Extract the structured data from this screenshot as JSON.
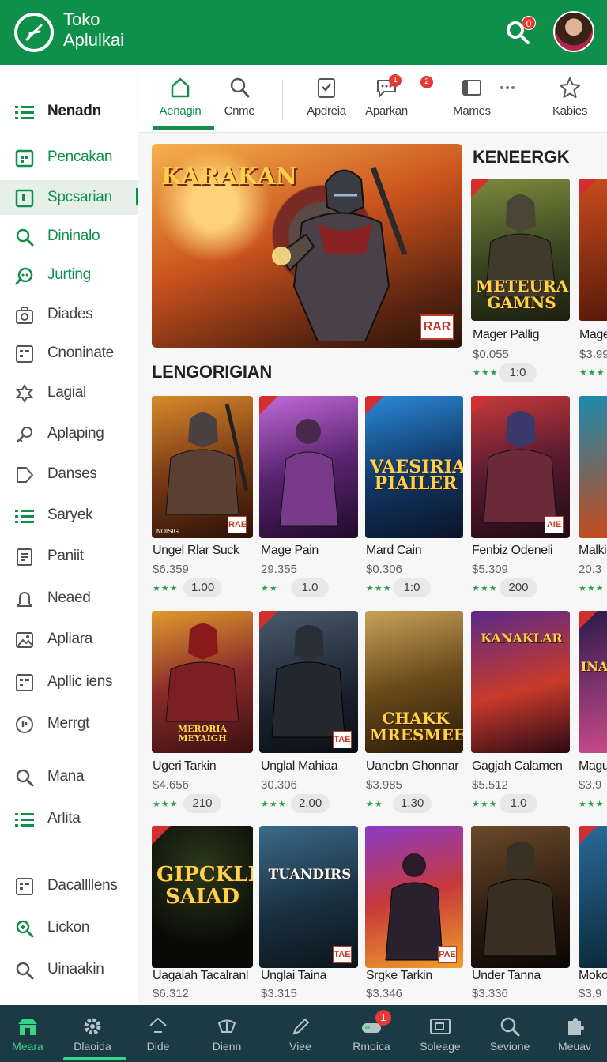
{
  "app": {
    "title": "Toko\nAplulkai",
    "title_line1": "Toko",
    "title_line2": "Aplulkai",
    "notification_count": "0",
    "brand_color": "#0e8f4a"
  },
  "sidebar": {
    "items": [
      {
        "label": "Nenadn",
        "icon": "list-icon"
      },
      {
        "label": "Pencakan",
        "icon": "calendar-icon"
      },
      {
        "label": "Spcsarian",
        "icon": "square-icon"
      },
      {
        "label": "Dininalo",
        "icon": "search-icon"
      },
      {
        "label": "Jurting",
        "icon": "chat-icon"
      },
      {
        "label": "Diades",
        "icon": "camera-icon"
      },
      {
        "label": "Cnoninate",
        "icon": "grid-icon"
      },
      {
        "label": "Lagial",
        "icon": "puzzle-icon"
      },
      {
        "label": "Aplaping",
        "icon": "key-icon"
      },
      {
        "label": "Danses",
        "icon": "tag-icon"
      },
      {
        "label": "Saryek",
        "icon": "list-icon"
      },
      {
        "label": "Paniit",
        "icon": "document-icon"
      },
      {
        "label": "Neaed",
        "icon": "bell-icon"
      },
      {
        "label": "Apliara",
        "icon": "image-icon"
      },
      {
        "label": "Apllic iens",
        "icon": "grid-icon"
      },
      {
        "label": "Merrgt",
        "icon": "clock-icon"
      },
      {
        "label": "Mana",
        "icon": "search-icon"
      },
      {
        "label": "Arlita",
        "icon": "list-icon"
      },
      {
        "label": "Dacallllens",
        "icon": "grid-icon"
      },
      {
        "label": "Lickon",
        "icon": "zoom-icon"
      },
      {
        "label": "Uinaakin",
        "icon": "search-icon"
      }
    ]
  },
  "tabs": [
    {
      "label": "Aenagin",
      "icon": "home-icon",
      "badge": ""
    },
    {
      "label": "Cnme",
      "icon": "search-icon",
      "badge": ""
    },
    {
      "label": "Apdreia",
      "icon": "checklist-icon",
      "badge": ""
    },
    {
      "label": "Aparkan",
      "icon": "chat-icon",
      "badge": "1"
    },
    {
      "label": "",
      "icon": "",
      "badge": "2"
    },
    {
      "label": "Mames",
      "icon": "window-icon",
      "badge": ""
    },
    {
      "label": "",
      "icon": "more-icon",
      "badge": ""
    },
    {
      "label": "Kabies",
      "icon": "star-icon",
      "badge": ""
    }
  ],
  "hero": {
    "title": "KARAKAN",
    "tag": "RAR"
  },
  "sections": {
    "right_title": "KENEERGK",
    "main_title": "LENGORIGIAN"
  },
  "featured": [
    {
      "name": "Mager Pallig",
      "price": "$0.055",
      "stars": "★★★",
      "rating": "1:0",
      "art_text": "METEURA GAMNS"
    },
    {
      "name": "Mage",
      "price": "$3.99",
      "stars": "★★★",
      "rating": "",
      "art_text": ""
    }
  ],
  "rows": [
    [
      {
        "name": "Ungel Rlar Suck",
        "price": "$6.359",
        "stars": "★★★",
        "rating": "1.00",
        "art_text": "",
        "tag": "RAE"
      },
      {
        "name": "Mage Pain",
        "price": "29.355",
        "stars": "★★",
        "rating": "1.0",
        "art_text": "",
        "tag": ""
      },
      {
        "name": "Mard Cain",
        "price": "$0.306",
        "stars": "★★★",
        "rating": "1:0",
        "art_text": "VAESIRIA PIAILER",
        "tag": ""
      },
      {
        "name": "Fenbiz Odeneli",
        "price": "$5.309",
        "stars": "★★★",
        "rating": "200",
        "art_text": "",
        "tag": "AIE"
      },
      {
        "name": "Malki",
        "price": "20.3",
        "stars": "★★★",
        "rating": "",
        "art_text": "",
        "tag": ""
      }
    ],
    [
      {
        "name": "Ugeri Tarkin",
        "price": "$4.656",
        "stars": "★★★",
        "rating": "210",
        "art_text": "MERORIA MEYAIGH",
        "tag": ""
      },
      {
        "name": "Unglal Mahiaa",
        "price": "30.306",
        "stars": "★★★",
        "rating": "2.00",
        "art_text": "",
        "tag": "TAE"
      },
      {
        "name": "Uanebn Ghonnar",
        "price": "$3.985",
        "stars": "★★",
        "rating": "1.30",
        "art_text": "CHAKK MRESMEES",
        "tag": ""
      },
      {
        "name": "Gagjah Calamen",
        "price": "$5.512",
        "stars": "★★★",
        "rating": "1.0",
        "art_text": "KANAKLAR",
        "tag": ""
      },
      {
        "name": "Magu",
        "price": "$3.9",
        "stars": "★★★",
        "rating": "",
        "art_text": "INA",
        "tag": ""
      }
    ],
    [
      {
        "name": "Uagaiah Tacalranl",
        "price": "$6.312",
        "stars": "",
        "rating": "",
        "art_text": "GIPCKLER SAIAD",
        "tag": ""
      },
      {
        "name": "Unglai Taina",
        "price": "$3.315",
        "stars": "",
        "rating": "",
        "art_text": "TUANDIRS",
        "tag": "TAE"
      },
      {
        "name": "Srgke Tarkin",
        "price": "$3.346",
        "stars": "",
        "rating": "",
        "art_text": "",
        "tag": "PAE"
      },
      {
        "name": "Under Tanna",
        "price": "$3.336",
        "stars": "",
        "rating": "",
        "art_text": "",
        "tag": ""
      },
      {
        "name": "Moko",
        "price": "$3.9",
        "stars": "",
        "rating": "",
        "art_text": "",
        "tag": ""
      }
    ]
  ],
  "bottom_nav": [
    {
      "label": "Meara",
      "icon": "store-icon",
      "badge": ""
    },
    {
      "label": "Dlaoida",
      "icon": "gear-icon",
      "badge": ""
    },
    {
      "label": "Dide",
      "icon": "diamond-icon",
      "badge": ""
    },
    {
      "label": "Dienn",
      "icon": "shield-icon",
      "badge": ""
    },
    {
      "label": "Viee",
      "icon": "pencil-icon",
      "badge": ""
    },
    {
      "label": "Rmoica",
      "icon": "gamepad-icon",
      "badge": "1"
    },
    {
      "label": "Soleage",
      "icon": "window-icon",
      "badge": ""
    },
    {
      "label": "Sevione",
      "icon": "search-icon",
      "badge": ""
    },
    {
      "label": "Meuav",
      "icon": "puzzle-icon",
      "badge": ""
    }
  ]
}
